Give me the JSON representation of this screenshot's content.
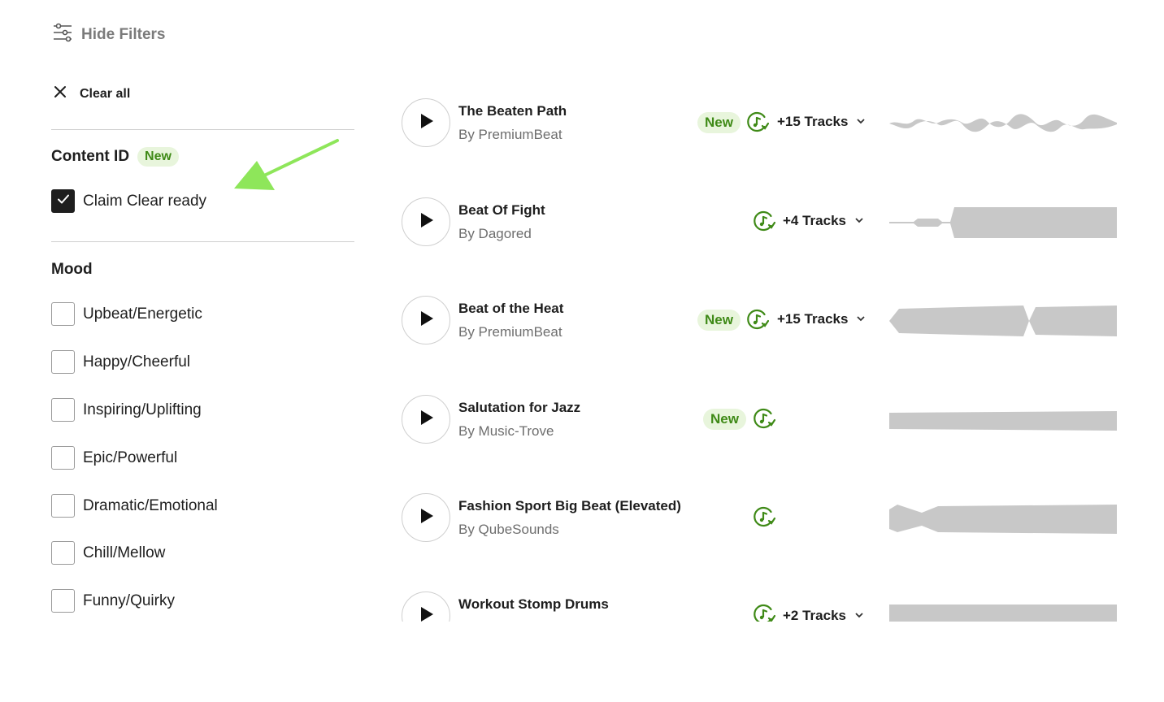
{
  "header": {
    "hide_filters_label": "Hide Filters"
  },
  "filters": {
    "clear_all_label": "Clear all",
    "content_id": {
      "title": "Content ID",
      "badge": "New",
      "option": {
        "label": "Claim Clear ready",
        "checked": true
      }
    },
    "mood": {
      "title": "Mood",
      "options": [
        {
          "label": "Upbeat/Energetic",
          "checked": false
        },
        {
          "label": "Happy/Cheerful",
          "checked": false
        },
        {
          "label": "Inspiring/Uplifting",
          "checked": false
        },
        {
          "label": "Epic/Powerful",
          "checked": false
        },
        {
          "label": "Dramatic/Emotional",
          "checked": false
        },
        {
          "label": "Chill/Mellow",
          "checked": false
        },
        {
          "label": "Funny/Quirky",
          "checked": false
        }
      ]
    }
  },
  "tracks": [
    {
      "title": "The Beaten Path",
      "artist": "By PremiumBeat",
      "badge": "New",
      "more_tracks": "+15 Tracks"
    },
    {
      "title": "Beat Of Fight",
      "artist": "By Dagored",
      "badge": "",
      "more_tracks": "+4 Tracks"
    },
    {
      "title": "Beat of the Heat",
      "artist": "By PremiumBeat",
      "badge": "New",
      "more_tracks": "+15 Tracks"
    },
    {
      "title": "Salutation for Jazz",
      "artist": "By Music-Trove",
      "badge": "New",
      "more_tracks": ""
    },
    {
      "title": "Fashion Sport Big Beat (Elevated)",
      "artist": "By QubeSounds",
      "badge": "",
      "more_tracks": ""
    },
    {
      "title": "Workout Stomp Drums",
      "artist": "",
      "badge": "",
      "more_tracks": "+2 Tracks"
    }
  ],
  "colors": {
    "accent_green": "#3f8a17",
    "badge_bg": "#e8f5dc",
    "annotation_arrow": "#8ee65a",
    "waveform": "#c8c8c8"
  },
  "icons": {
    "filter": "sliders-icon",
    "clear": "close-icon",
    "check": "checkmark-icon",
    "play": "play-icon",
    "content_id": "claim-clear-icon",
    "expand": "chevron-down-icon"
  }
}
